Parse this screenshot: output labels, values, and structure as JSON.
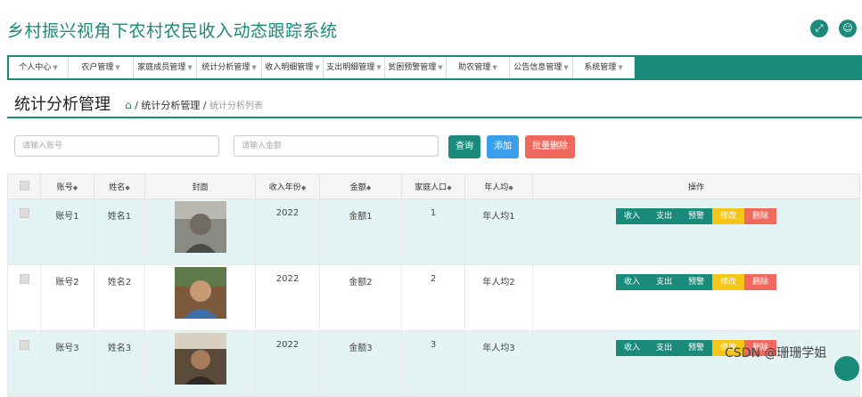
{
  "app": {
    "title": "乡村振兴视角下农村农民收入动态跟踪系统"
  },
  "header_icons": {
    "fullscreen": "expand-icon",
    "user": "user-icon"
  },
  "nav": [
    "个人中心",
    "农户管理",
    "家庭成员管理",
    "统计分析管理",
    "收入明细管理",
    "支出明细管理",
    "贫困预警管理",
    "助农管理",
    "公告信息管理",
    "系统管理"
  ],
  "page": {
    "title": "统计分析管理",
    "breadcrumb": {
      "sep": "/",
      "parent": "统计分析管理",
      "current": "统计分析列表"
    }
  },
  "search": {
    "account_placeholder": "请输入账号",
    "amount_placeholder": "请输入金额",
    "query_label": "查询",
    "add_label": "添加",
    "batch_delete_label": "批量删除"
  },
  "table": {
    "headers": [
      "账号",
      "姓名",
      "封面",
      "收入年份",
      "金额",
      "家庭人口",
      "年人均",
      "操作"
    ],
    "rows": [
      {
        "account": "账号1",
        "name": "姓名1",
        "year": "2022",
        "amount": "金额1",
        "population": "1",
        "per_capita": "年人均1"
      },
      {
        "account": "账号2",
        "name": "姓名2",
        "year": "2022",
        "amount": "金额2",
        "population": "2",
        "per_capita": "年人均2"
      },
      {
        "account": "账号3",
        "name": "姓名3",
        "year": "2022",
        "amount": "金额3",
        "population": "3",
        "per_capita": "年人均3"
      }
    ],
    "actions": [
      "收入",
      "支出",
      "预警",
      "修改",
      "删除"
    ]
  },
  "colors": {
    "primary": "#1a8a7a",
    "add": "#3a9ee8",
    "delete": "#f0695f",
    "edit": "#f5c518",
    "row_alt": "#e4f4f4"
  },
  "watermark": "CSDN @珊珊学姐"
}
